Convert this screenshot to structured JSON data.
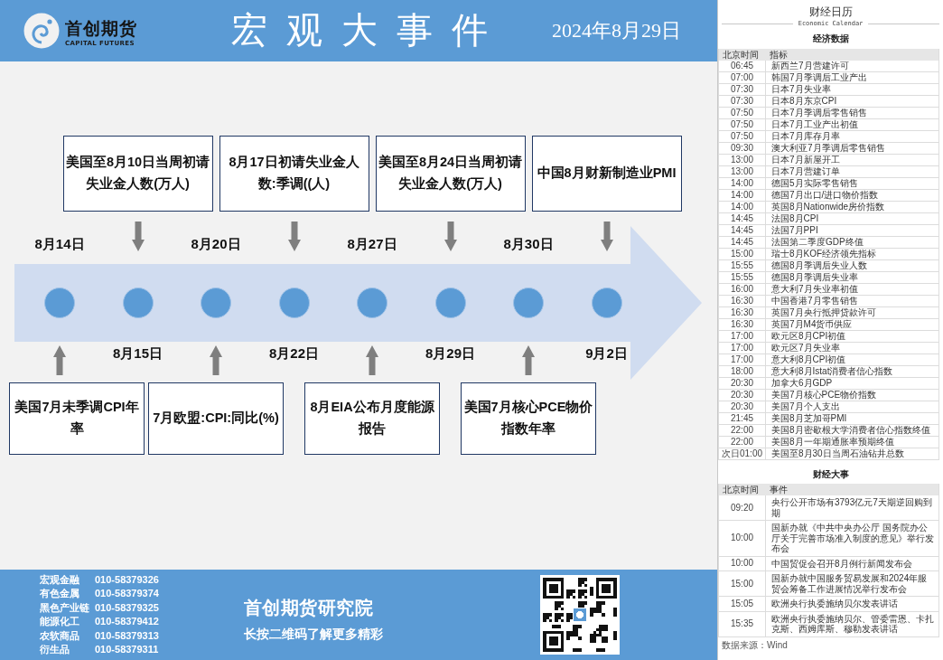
{
  "header": {
    "brand": "首创期货",
    "brand_en": "CAPITAL FUTURES",
    "title": "宏观大事件",
    "date": "2024年8月29日"
  },
  "timeline": {
    "events": [
      {
        "date": "8月14日",
        "description": "美国7月未季调CPI年率",
        "kind": "bottom"
      },
      {
        "date": "8月15日",
        "description": "美国至8月10日当周初请失业金人数(万人)",
        "kind": "top"
      },
      {
        "date": "8月20日",
        "description": "7月欧盟:CPI:同比(%)",
        "kind": "bottom"
      },
      {
        "date": "8月22日",
        "description": "8月17日初请失业金人数:季调((人)",
        "kind": "top"
      },
      {
        "date": "8月27日",
        "description": "8月EIA公布月度能源报告",
        "kind": "bottom"
      },
      {
        "date": "8月29日",
        "description": "美国至8月24日当周初请失业金人数(万人)",
        "kind": "top"
      },
      {
        "date": "8月30日",
        "description": "美国7月核心PCE物价指数年率",
        "kind": "bottom"
      },
      {
        "date": "9月2日",
        "description": "中国8月财新制造业PMI",
        "kind": "top"
      }
    ]
  },
  "footer": {
    "contacts": [
      {
        "label": "宏观金融",
        "phone": "010-58379326"
      },
      {
        "label": "有色金属",
        "phone": "010-58379374"
      },
      {
        "label": "黑色产业链",
        "phone": "010-58379325"
      },
      {
        "label": "能源化工",
        "phone": "010-58379412"
      },
      {
        "label": "农软商品",
        "phone": "010-58379313"
      },
      {
        "label": "衍生品",
        "phone": "010-58379311"
      }
    ],
    "institute": "首创期货研究院",
    "slogan": "长按二维码了解更多精彩"
  },
  "sidebar": {
    "title": "财经日历",
    "subtitle": "Economic Calendar",
    "data_section": {
      "heading": "经济数据",
      "columns": [
        "北京时间",
        "指标"
      ],
      "rows": [
        {
          "time": "06:45",
          "indicator": "新西兰7月营建许可"
        },
        {
          "time": "07:00",
          "indicator": "韩国7月季调后工业产出"
        },
        {
          "time": "07:30",
          "indicator": "日本7月失业率"
        },
        {
          "time": "07:30",
          "indicator": "日本8月东京CPI"
        },
        {
          "time": "07:50",
          "indicator": "日本7月季调后零售销售"
        },
        {
          "time": "07:50",
          "indicator": "日本7月工业产出初值"
        },
        {
          "time": "07:50",
          "indicator": "日本7月库存月率"
        },
        {
          "time": "09:30",
          "indicator": "澳大利亚7月季调后零售销售"
        },
        {
          "time": "13:00",
          "indicator": "日本7月新屋开工"
        },
        {
          "time": "13:00",
          "indicator": "日本7月营建订单"
        },
        {
          "time": "14:00",
          "indicator": "德国5月实际零售销售"
        },
        {
          "time": "14:00",
          "indicator": "德国7月出口/进口物价指数"
        },
        {
          "time": "14:00",
          "indicator": "英国8月Nationwide房价指数"
        },
        {
          "time": "14:45",
          "indicator": "法国8月CPI"
        },
        {
          "time": "14:45",
          "indicator": "法国7月PPI"
        },
        {
          "time": "14:45",
          "indicator": "法国第二季度GDP终值"
        },
        {
          "time": "15:00",
          "indicator": "瑞士8月KOF经济领先指标"
        },
        {
          "time": "15:55",
          "indicator": "德国8月季调后失业人数"
        },
        {
          "time": "15:55",
          "indicator": "德国8月季调后失业率"
        },
        {
          "time": "16:00",
          "indicator": "意大利7月失业率初值"
        },
        {
          "time": "16:30",
          "indicator": "中国香港7月零售销售"
        },
        {
          "time": "16:30",
          "indicator": "英国7月央行抵押贷款许可"
        },
        {
          "time": "16:30",
          "indicator": "英国7月M4货币供应"
        },
        {
          "time": "17:00",
          "indicator": "欧元区8月CPI初值"
        },
        {
          "time": "17:00",
          "indicator": "欧元区7月失业率"
        },
        {
          "time": "17:00",
          "indicator": "意大利8月CPI初值"
        },
        {
          "time": "18:00",
          "indicator": "意大利8月Istat消费者信心指数"
        },
        {
          "time": "20:30",
          "indicator": "加拿大6月GDP"
        },
        {
          "time": "20:30",
          "indicator": "美国7月核心PCE物价指数"
        },
        {
          "time": "20:30",
          "indicator": "美国7月个人支出"
        },
        {
          "time": "21:45",
          "indicator": "美国8月芝加哥PMI"
        },
        {
          "time": "22:00",
          "indicator": "美国8月密歇根大学消费者信心指数终值"
        },
        {
          "time": "22:00",
          "indicator": "美国8月一年期通胀率预期终值"
        },
        {
          "time": "次日01:00",
          "indicator": "美国至8月30日当周石油钻井总数"
        }
      ]
    },
    "events_section": {
      "heading": "财经大事",
      "columns": [
        "北京时间",
        "事件"
      ],
      "rows": [
        {
          "time": "09:20",
          "event": "央行公开市场有3793亿元7天期逆回购到期"
        },
        {
          "time": "10:00",
          "event": "国新办就《中共中央办公厅 国务院办公厅关于完善市场准入制度的意见》举行发布会"
        },
        {
          "time": "10:00",
          "event": "中国贸促会召开8月例行新闻发布会"
        },
        {
          "time": "15:00",
          "event": "国新办就中国服务贸易发展和2024年服贸会筹备工作进展情况举行发布会"
        },
        {
          "time": "15:05",
          "event": "欧洲央行执委施纳贝尔发表讲话"
        },
        {
          "time": "15:35",
          "event": "欧洲央行执委施纳贝尔、管委雷恩、卡扎克斯、西姆库斯、穆勒发表讲话"
        }
      ]
    },
    "source": "数据来源：Wind"
  }
}
